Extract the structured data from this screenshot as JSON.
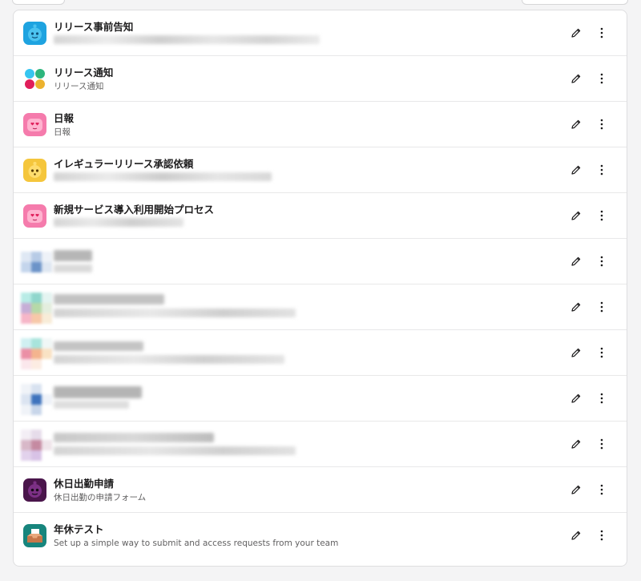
{
  "workflows": [
    {
      "name": "リリース事前告知",
      "description": "",
      "icon": "blue-robot-icon",
      "icon_color": "#1ea3e0"
    },
    {
      "name": "リリース通知",
      "description": "リリース通知",
      "icon": "slack-logo-icon",
      "icon_color": "#e01e5a"
    },
    {
      "name": "日報",
      "description": "日報",
      "icon": "pink-robot-heart-eyes-icon",
      "icon_color": "#f57bac"
    },
    {
      "name": "イレギュラーリリース承認依頼",
      "description": "",
      "icon": "yellow-robot-icon",
      "icon_color": "#f5c63c"
    },
    {
      "name": "新規サービス導入利用開始プロセス",
      "description": "",
      "icon": "pink-robot-heart-eyes-icon",
      "icon_color": "#f57bac"
    },
    {
      "name": "",
      "description": "",
      "icon": "blurred-app-icon",
      "icon_color": "#6c93c8"
    },
    {
      "name": "",
      "description": "",
      "icon": "blurred-app-icon",
      "icon_color": "#8fd6cc"
    },
    {
      "name": "",
      "description": "",
      "icon": "blurred-app-icon",
      "icon_color": "#eb8fa6"
    },
    {
      "name": "",
      "description": "",
      "icon": "blurred-app-icon",
      "icon_color": "#3e73bd"
    },
    {
      "name": "",
      "description": "",
      "icon": "blurred-app-icon",
      "icon_color": "#c58aa1"
    },
    {
      "name": "休日出勤申請",
      "description": "休日出勤の申請フォーム",
      "icon": "purple-robot-icon",
      "icon_color": "#4a154b"
    },
    {
      "name": "年休テスト",
      "description": "Set up a simple way to submit and access requests from your team",
      "icon": "inbox-tray-icon",
      "icon_color": "#17857d"
    }
  ],
  "actions": {
    "edit_icon": "pencil-icon",
    "more_icon": "more-vertical-icon"
  }
}
